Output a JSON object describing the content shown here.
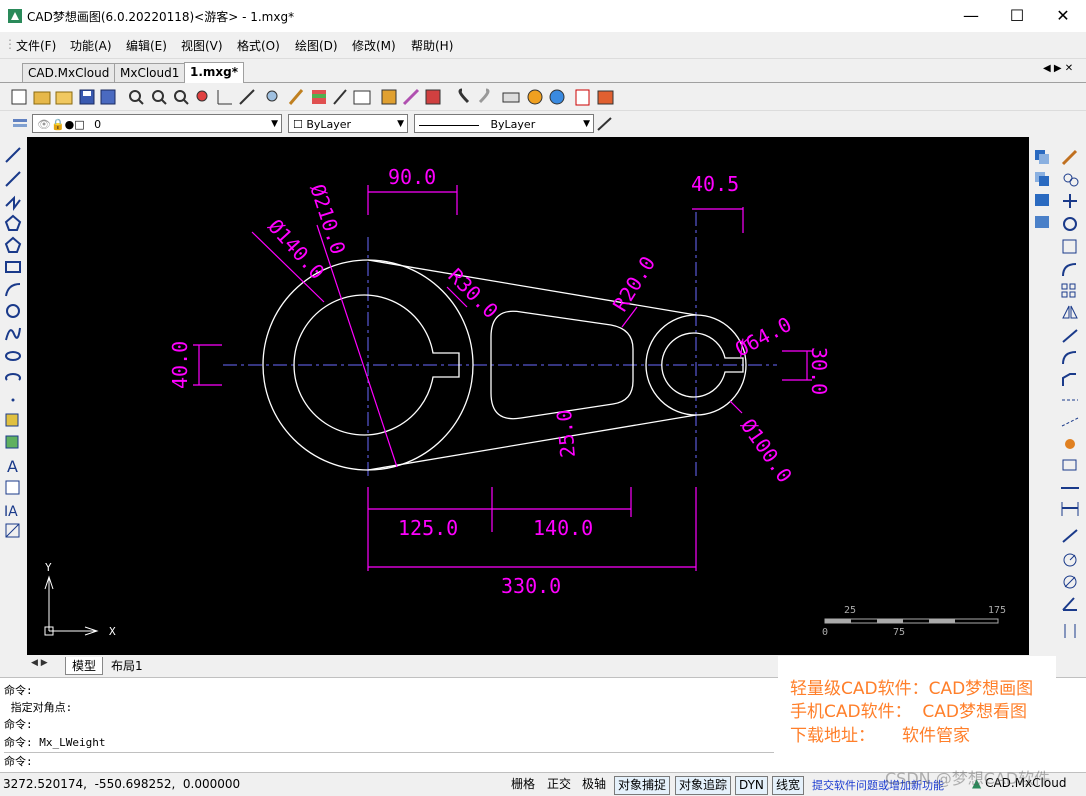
{
  "window": {
    "title": "CAD梦想画图(6.0.20220118)<游客> - 1.mxg*",
    "minimize": "—",
    "maximize": "☐",
    "close": "✕"
  },
  "menu": [
    "文件(F)",
    "功能(A)",
    "编辑(E)",
    "视图(V)",
    "格式(O)",
    "绘图(D)",
    "修改(M)",
    "帮助(H)"
  ],
  "tabs": [
    "CAD.MxCloud",
    "MxCloud1",
    "1.mxg*"
  ],
  "tab_nav": "◀ ▶ ✕",
  "layer_combo": "0",
  "color_combo": "ByLayer",
  "linetype_combo": "ByLayer",
  "drawing": {
    "dimensions": [
      "90.0",
      "40.5",
      "Ø210.0",
      "Ø140.0",
      "R30.0",
      "R20.0",
      "Ø64.0",
      "40.0",
      "30.0",
      "25.0",
      "Ø100.0",
      "125.0",
      "140.0",
      "330.0"
    ],
    "ucs_y": "Y",
    "ucs_x": "X",
    "scale_labels": [
      "25",
      "175",
      "0",
      "75"
    ]
  },
  "layout_tabs": [
    "模型",
    "布局1"
  ],
  "layout_nav": "◀ ▶",
  "command_lines": [
    "命令:",
    " 指定对角点:",
    "命令:",
    "命令: Mx_LWeight",
    "命令:"
  ],
  "status": {
    "coords": "3272.520174,  -550.698252,  0.000000",
    "buttons": [
      "栅格",
      "正交",
      "极轴",
      "对象捕捉",
      "对象追踪",
      "DYN",
      "线宽"
    ],
    "buttons_on": [
      false,
      false,
      false,
      true,
      true,
      true,
      true
    ],
    "link": "提交软件问题或增加新功能",
    "brand": "CAD.MxCloud"
  },
  "ad": {
    "line1": "轻量级CAD软件：CAD梦想画图",
    "line2": "手机CAD软件：  CAD梦想看图",
    "line3": "下载地址：     软件管家"
  },
  "watermark": "CSDN @梦想CAD软件",
  "colors": {
    "canvas": "#000000",
    "geometry": "#ffffff",
    "dimension": "#ff00ff",
    "centerline": "#6a6aff",
    "ad_text": "#ff7f2a"
  }
}
